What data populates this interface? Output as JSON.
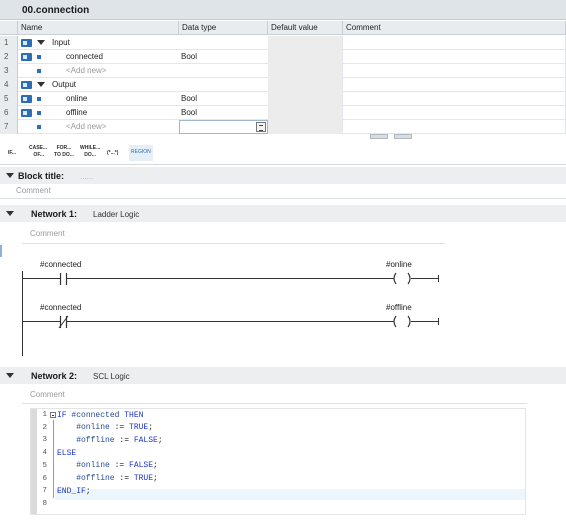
{
  "interface": {
    "title": "00.connection",
    "columns": {
      "name": "Name",
      "data_type": "Data type",
      "default_value": "Default value",
      "comment": "Comment"
    },
    "rows": [
      {
        "num": "1",
        "name": "Input",
        "data_type": ""
      },
      {
        "num": "2",
        "name": "connected",
        "data_type": "Bool"
      },
      {
        "num": "3",
        "name": "<Add new>",
        "data_type": ""
      },
      {
        "num": "4",
        "name": "Output",
        "data_type": ""
      },
      {
        "num": "5",
        "name": "online",
        "data_type": "Bool"
      },
      {
        "num": "6",
        "name": "offline",
        "data_type": "Bool"
      },
      {
        "num": "7",
        "name": "<Add new>",
        "data_type": ""
      }
    ]
  },
  "toolbar": {
    "if": "IF...",
    "case": "CASE...\n OF...",
    "for": "FOR...\nTO DO...",
    "while": "WHILE...\nDO...",
    "comment": "(*...*)",
    "region": "REGION"
  },
  "block": {
    "title_label": "Block title:",
    "title_value": "......",
    "comment": "Comment"
  },
  "network1": {
    "label": "Network 1:",
    "title": "Ladder Logic",
    "comment": "Comment",
    "rungs": [
      {
        "contact": "#connected",
        "contact_type": "NO",
        "coil": "#online"
      },
      {
        "contact": "#connected",
        "contact_type": "NC",
        "coil": "#offline"
      }
    ]
  },
  "network2": {
    "label": "Network 2:",
    "title": "SCL Logic",
    "comment": "Comment",
    "lines": [
      {
        "n": "1",
        "tokens": [
          {
            "t": "IF",
            "k": "kw"
          },
          {
            "t": " #connected ",
            "k": "var"
          },
          {
            "t": "THEN",
            "k": "kw"
          }
        ]
      },
      {
        "n": "2",
        "tokens": [
          {
            "t": "    #online",
            "k": "var"
          },
          {
            "t": " := ",
            "k": ""
          },
          {
            "t": "TRUE",
            "k": "kw"
          },
          {
            "t": ";",
            "k": ""
          }
        ]
      },
      {
        "n": "3",
        "tokens": [
          {
            "t": "    #offline",
            "k": "var"
          },
          {
            "t": " := ",
            "k": ""
          },
          {
            "t": "FALSE",
            "k": "kw"
          },
          {
            "t": ";",
            "k": ""
          }
        ]
      },
      {
        "n": "4",
        "tokens": [
          {
            "t": "ELSE",
            "k": "kw"
          }
        ]
      },
      {
        "n": "5",
        "tokens": [
          {
            "t": "    #online",
            "k": "var"
          },
          {
            "t": " := ",
            "k": ""
          },
          {
            "t": "FALSE",
            "k": "kw"
          },
          {
            "t": ";",
            "k": ""
          }
        ]
      },
      {
        "n": "6",
        "tokens": [
          {
            "t": "    #offline",
            "k": "var"
          },
          {
            "t": " := ",
            "k": ""
          },
          {
            "t": "TRUE",
            "k": "kw"
          },
          {
            "t": ";",
            "k": ""
          }
        ]
      },
      {
        "n": "7",
        "tokens": [
          {
            "t": "END_IF",
            "k": "kw"
          },
          {
            "t": ";",
            "k": ""
          }
        ]
      },
      {
        "n": "8",
        "tokens": []
      }
    ]
  },
  "colors": {
    "accent": "#2d6db3",
    "keyword": "#1c35c9",
    "header_bg": "#dfe4e9"
  }
}
